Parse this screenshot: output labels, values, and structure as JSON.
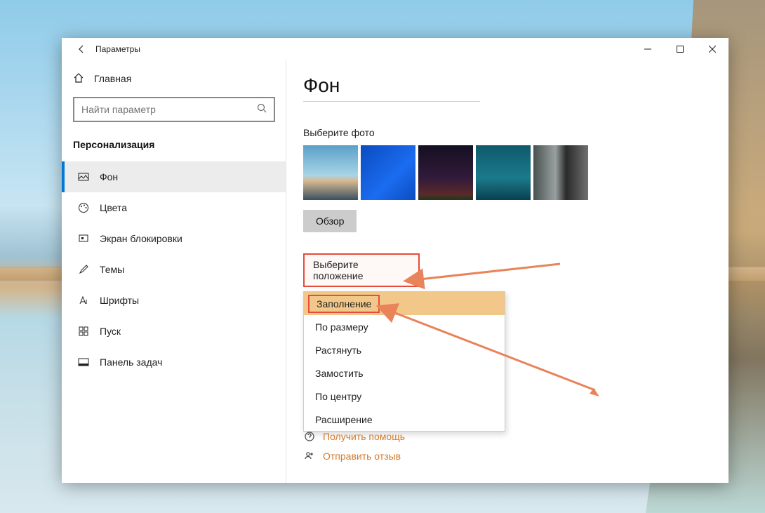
{
  "window": {
    "title": "Параметры"
  },
  "sidebar": {
    "home": "Главная",
    "search_placeholder": "Найти параметр",
    "section": "Персонализация",
    "items": [
      {
        "label": "Фон"
      },
      {
        "label": "Цвета"
      },
      {
        "label": "Экран блокировки"
      },
      {
        "label": "Темы"
      },
      {
        "label": "Шрифты"
      },
      {
        "label": "Пуск"
      },
      {
        "label": "Панель задач"
      }
    ]
  },
  "page": {
    "title": "Фон",
    "choose_photo": "Выберите фото",
    "browse": "Обзор",
    "fit_label": "Выберите положение",
    "options": [
      "Заполнение",
      "По размеру",
      "Растянуть",
      "Замостить",
      "По центру",
      "Расширение"
    ]
  },
  "links": {
    "help": "Получить помощь",
    "feedback": "Отправить отзыв"
  }
}
